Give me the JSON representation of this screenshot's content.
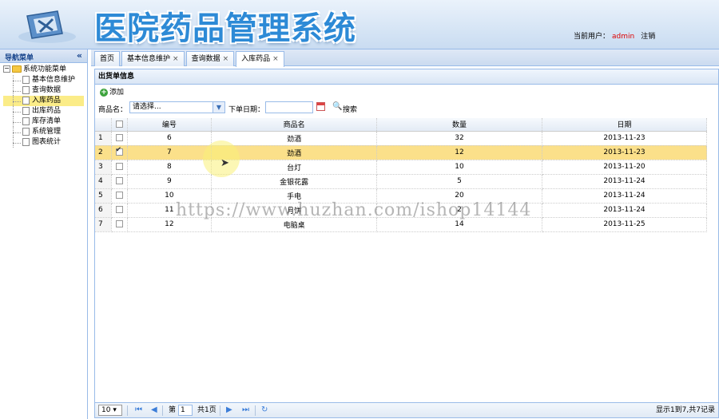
{
  "app": {
    "title": "医院药品管理系统"
  },
  "header": {
    "user_label": "当前用户：",
    "user_name": "admin",
    "logout": "注销"
  },
  "sidebar": {
    "title": "导航菜单",
    "root": "系统功能菜单",
    "items": [
      {
        "label": "基本信息维护",
        "selected": false
      },
      {
        "label": "查询数据",
        "selected": false
      },
      {
        "label": "入库药品",
        "selected": true
      },
      {
        "label": "出库药品",
        "selected": false
      },
      {
        "label": "库存清单",
        "selected": false
      },
      {
        "label": "系统管理",
        "selected": false
      },
      {
        "label": "图表统计",
        "selected": false
      }
    ]
  },
  "tabs": [
    {
      "label": "首页",
      "closable": false
    },
    {
      "label": "基本信息维护",
      "closable": true
    },
    {
      "label": "查询数据",
      "closable": true
    },
    {
      "label": "入库药品",
      "closable": true,
      "active": true
    }
  ],
  "panel": {
    "title": "出货单信息",
    "add_label": "添加",
    "search": {
      "product_label": "商品名：",
      "product_value": "请选择...",
      "date_label": "下单日期：",
      "date_value": "",
      "search_label": "搜索"
    }
  },
  "grid": {
    "columns": [
      "编号",
      "商品名",
      "数量",
      "日期"
    ],
    "rows": [
      {
        "num": "1",
        "checked": false,
        "id": "6",
        "name": "劲酒",
        "qty": "32",
        "date": "2013-11-23"
      },
      {
        "num": "2",
        "checked": true,
        "id": "7",
        "name": "劲酒",
        "qty": "12",
        "date": "2013-11-23"
      },
      {
        "num": "3",
        "checked": false,
        "id": "8",
        "name": "台灯",
        "qty": "10",
        "date": "2013-11-20"
      },
      {
        "num": "4",
        "checked": false,
        "id": "9",
        "name": "金银花露",
        "qty": "5",
        "date": "2013-11-24"
      },
      {
        "num": "5",
        "checked": false,
        "id": "10",
        "name": "手电",
        "qty": "20",
        "date": "2013-11-24"
      },
      {
        "num": "6",
        "checked": false,
        "id": "11",
        "name": "月饼",
        "qty": "2",
        "date": "2013-11-24"
      },
      {
        "num": "7",
        "checked": false,
        "id": "12",
        "name": "电脑桌",
        "qty": "14",
        "date": "2013-11-25"
      }
    ]
  },
  "pager": {
    "page_size": "10",
    "page_label": "第",
    "page_value": "1",
    "total_pages": "共1页",
    "summary": "显示1到7,共7记录"
  },
  "watermark": "https://www.huzhan.com/ishop14144"
}
